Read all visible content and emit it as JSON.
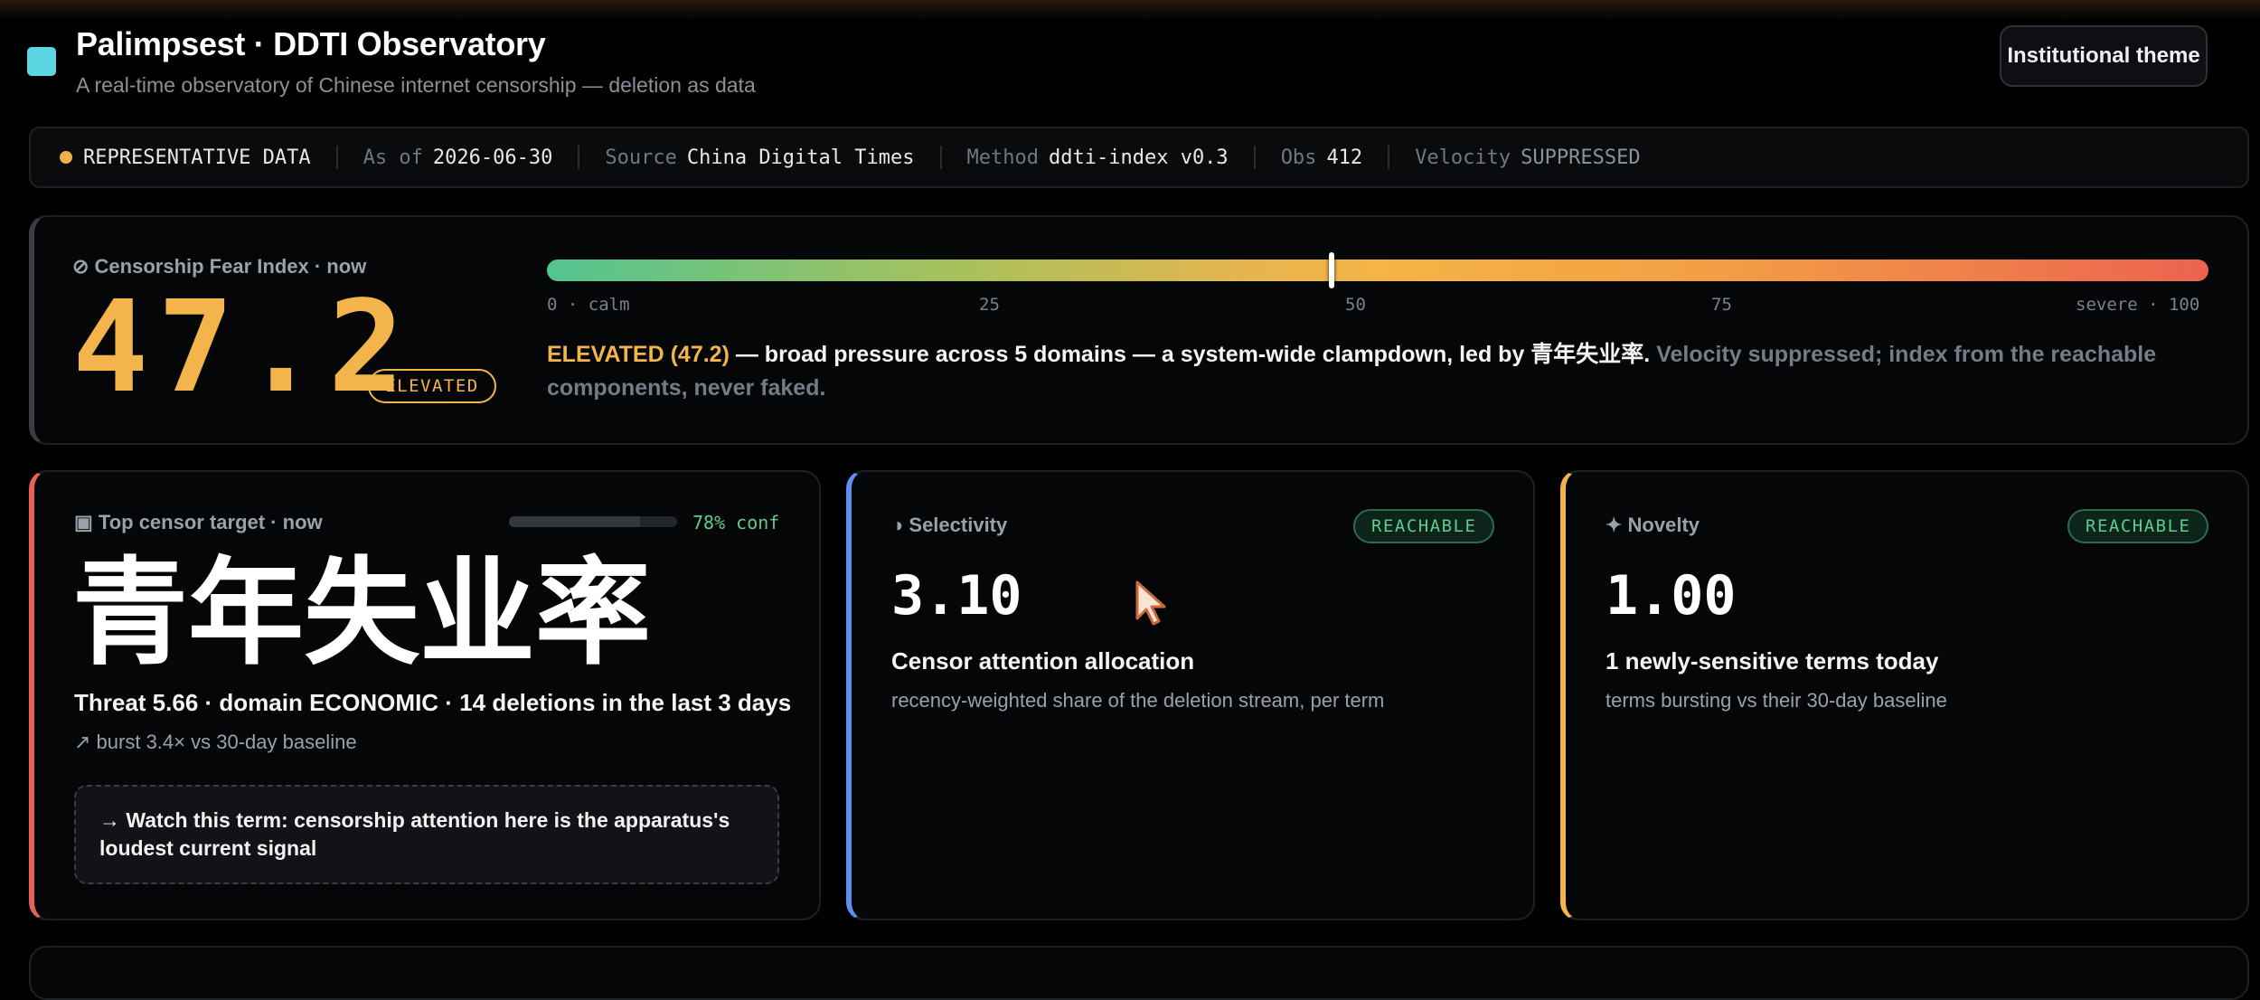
{
  "header": {
    "title": "Palimpsest · DDTI Observatory",
    "subtitle": "A real-time observatory of Chinese internet censorship — deletion as data",
    "theme_button": "Institutional theme"
  },
  "status": {
    "representative": "REPRESENTATIVE DATA",
    "as_of_label": "As of",
    "as_of_value": "2026-06-30",
    "source_label": "Source",
    "source_value": "China Digital Times",
    "method_label": "Method",
    "method_value": "ddti-index v0.3",
    "obs_label": "Obs",
    "obs_value": "412",
    "velocity_label": "Velocity",
    "velocity_value": "SUPPRESSED"
  },
  "fear_index": {
    "label": "⊘ Censorship Fear Index · now",
    "value": "47.2",
    "gauge_value": 47.2,
    "gauge_max": 100,
    "badge": "ELEVATED",
    "ticks": [
      "0 · calm",
      "25",
      "50",
      "75",
      "severe · 100"
    ],
    "desc_accent": "ELEVATED (47.2)",
    "desc_main": " — broad pressure across 5 domains — a system-wide clampdown, led by 青年失业率. ",
    "desc_muted": "Velocity suppressed; index from the reachable components, never faked."
  },
  "top_target": {
    "label": "▣ Top censor target · now",
    "confidence": 0.78,
    "confidence_text": "78% conf",
    "term": "青年失业率",
    "threat_line": "Threat 5.66 · domain ECONOMIC · 14 deletions in the last 3 days",
    "burst_line": "↗ burst 3.4× vs 30-day baseline",
    "watch_text": "→ Watch this term: censorship attention here is the apparatus's loudest current signal"
  },
  "selectivity": {
    "label": "◑ Selectivity",
    "badge": "REACHABLE",
    "value": "3.10",
    "title": "Censor attention allocation",
    "desc": "recency-weighted share of the deletion stream, per term"
  },
  "novelty": {
    "label": "✦ Novelty",
    "badge": "REACHABLE",
    "value": "1.00",
    "title": "1 newly-sensitive terms today",
    "desc": "terms bursting vs their 30-day baseline"
  },
  "colors": {
    "accent": "#f3b44c",
    "logo": "#5bd6e2",
    "reachable": "#5fcc8e",
    "threat_red": "#e86057",
    "selectivity_blue": "#5d8ff0"
  }
}
